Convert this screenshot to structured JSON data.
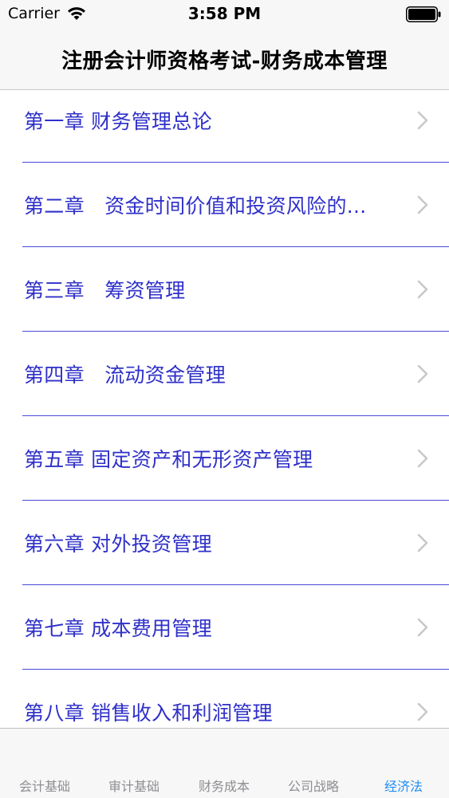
{
  "status_bar": {
    "carrier": "Carrier",
    "time": "3:58 PM"
  },
  "nav": {
    "title": "注册会计师资格考试-财务成本管理"
  },
  "chapters": [
    {
      "label": "第一章 财务管理总论"
    },
    {
      "label": "第二章　资金时间价值和投资风险的..."
    },
    {
      "label": "第三章　筹资管理"
    },
    {
      "label": "第四章　流动资金管理"
    },
    {
      "label": "第五章 固定资产和无形资产管理"
    },
    {
      "label": "第六章 对外投资管理"
    },
    {
      "label": "第七章 成本费用管理"
    },
    {
      "label": "第八章 销售收入和利润管理"
    }
  ],
  "tabs": [
    {
      "label": "会计基础",
      "active": false
    },
    {
      "label": "审计基础",
      "active": false
    },
    {
      "label": "财务成本",
      "active": false
    },
    {
      "label": "公司战略",
      "active": false
    },
    {
      "label": "经济法",
      "active": true
    }
  ],
  "colors": {
    "chapter_text": "#2f30c9",
    "separator": "#4a4ad8",
    "tab_active": "#1e8df2",
    "tab_inactive": "#8e8e93"
  }
}
